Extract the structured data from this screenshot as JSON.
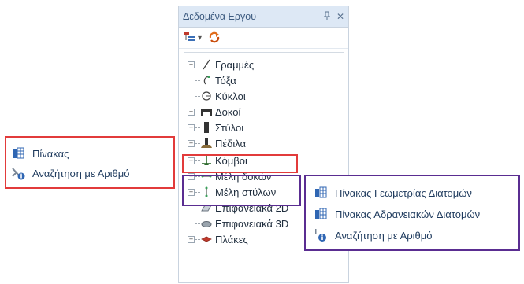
{
  "panel": {
    "title": "Δεδομένα Εργου",
    "pin_glyph": "ᵠ",
    "close_glyph": "✕",
    "toolbar": {
      "dropdown_arrow": "▾"
    }
  },
  "tree": {
    "items": [
      {
        "label": "Γραμμές",
        "icon": "line-icon",
        "expandable": true
      },
      {
        "label": "Τόξα",
        "icon": "arc-icon",
        "expandable": false
      },
      {
        "label": "Κύκλοι",
        "icon": "circle-icon",
        "expandable": false
      },
      {
        "label": "Δοκοί",
        "icon": "beam-icon",
        "expandable": true
      },
      {
        "label": "Στύλοι",
        "icon": "column-icon",
        "expandable": true
      },
      {
        "label": "Πέδιλα",
        "icon": "footing-icon",
        "expandable": true
      },
      {
        "label": "Κόμβοι",
        "icon": "node-icon",
        "expandable": true
      },
      {
        "label": "Μέλη δοκών",
        "icon": "beam-member-icon",
        "expandable": true
      },
      {
        "label": "Μέλη στύλων",
        "icon": "column-member-icon",
        "expandable": true
      },
      {
        "label": "Επιφανειακά 2D",
        "icon": "surface-2d-icon",
        "expandable": false
      },
      {
        "label": "Επιφανειακά 3D",
        "icon": "surface-3d-icon",
        "expandable": false
      },
      {
        "label": "Πλάκες",
        "icon": "slab-icon",
        "expandable": true
      }
    ],
    "expander_glyph": "+"
  },
  "node_menu": {
    "items": [
      {
        "label": "Πίνακας",
        "icon": "table-icon"
      },
      {
        "label": "Αναζήτηση με Αριθμό",
        "icon": "search-by-number-icon"
      }
    ]
  },
  "member_menu": {
    "items": [
      {
        "label": "Πίνακας Γεωμετρίας Διατομών",
        "icon": "table-icon"
      },
      {
        "label": "Πίνακας Αδρανειακών Διατομών",
        "icon": "table-icon"
      },
      {
        "label": "Αναζήτηση με Αριθμό",
        "icon": "search-by-number-icon"
      }
    ]
  },
  "colors": {
    "highlight_red": "#e23b3b",
    "highlight_purple": "#5a2d91",
    "panel_title_bg": "#dde8f5",
    "menu_text": "#1f3b5e"
  }
}
